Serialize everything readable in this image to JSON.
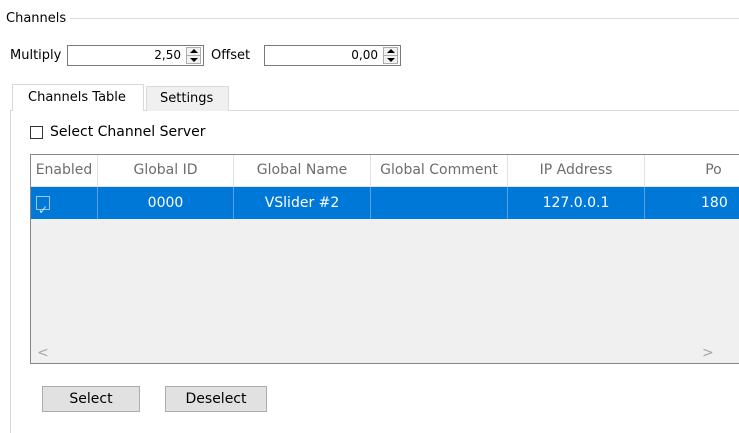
{
  "group": {
    "title": "Channels"
  },
  "multiply": {
    "label": "Multiply",
    "value": "2,50"
  },
  "offset": {
    "label": "Offset",
    "value": "0,00"
  },
  "tabs": [
    {
      "label": "Channels Table",
      "active": true
    },
    {
      "label": "Settings",
      "active": false
    }
  ],
  "select_server": {
    "label": "Select Channel Server",
    "checked": false
  },
  "table": {
    "columns": [
      "Enabled",
      "Global ID",
      "Global Name",
      "Global Comment",
      "IP Address",
      "Po"
    ],
    "rows": [
      {
        "enabled": true,
        "global_id": "0000",
        "global_name": "VSlider #2",
        "global_comment": "",
        "ip_address": "127.0.0.1",
        "port": "180"
      }
    ],
    "scroll_left": "<",
    "scroll_right": ">"
  },
  "buttons": {
    "select": "Select",
    "deselect": "Deselect"
  },
  "colors": {
    "selection": "#0078d7",
    "border": "#7a7a7a",
    "button_bg": "#e1e1e1"
  },
  "icons": {
    "checkmark": "✓"
  }
}
